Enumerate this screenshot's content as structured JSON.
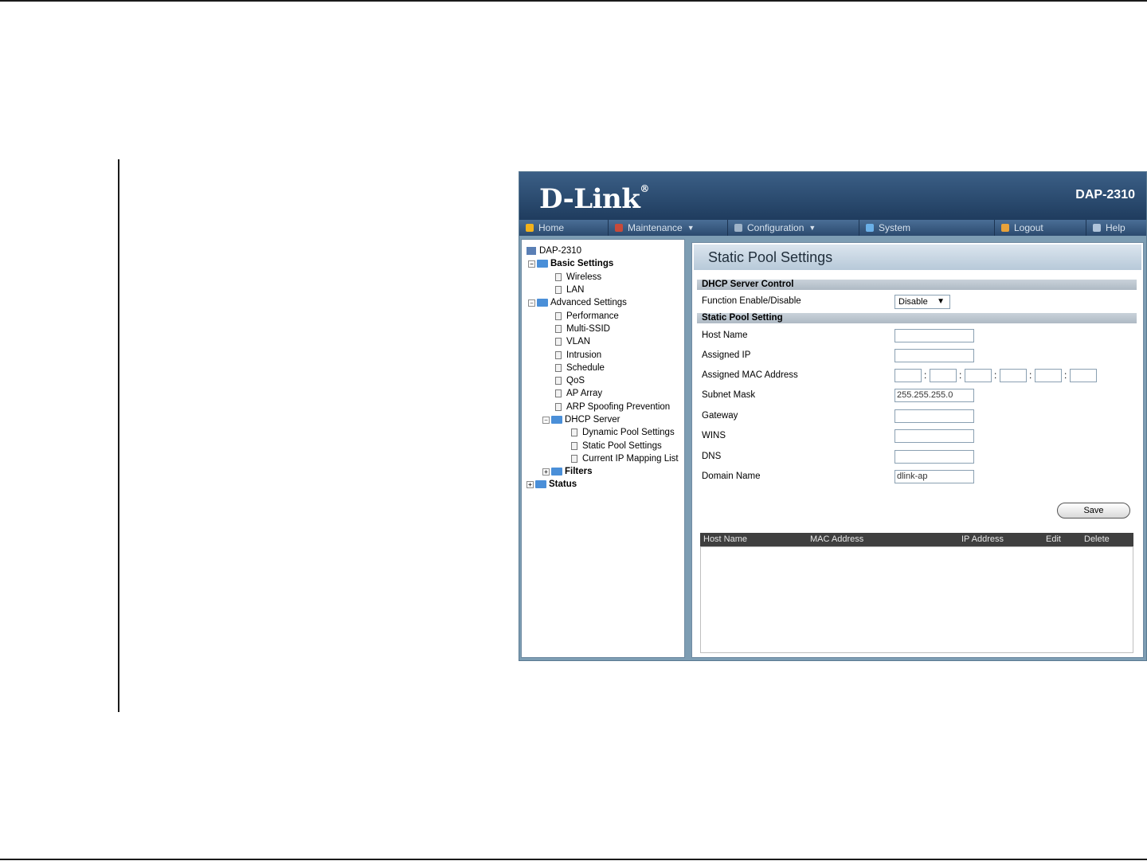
{
  "app": {
    "brand": "D-Link",
    "model": "DAP-2310"
  },
  "menu": [
    {
      "label": "Home",
      "color": "#f3b21b"
    },
    {
      "label": "Maintenance",
      "color": "#c74a3a",
      "has_caret": true
    },
    {
      "label": "Configuration",
      "color": "#9fb3c8",
      "has_caret": true
    },
    {
      "label": "System",
      "color": "#6ab0e8"
    },
    {
      "label": "Logout",
      "color": "#e8a23a"
    },
    {
      "label": "Help",
      "color": "#b0c4da"
    }
  ],
  "tree": {
    "root": "DAP-2310",
    "basic": "Basic Settings",
    "wireless": "Wireless",
    "lan": "LAN",
    "advanced": "Advanced Settings",
    "performance": "Performance",
    "multi_ssid": "Multi-SSID",
    "vlan": "VLAN",
    "intrusion": "Intrusion",
    "schedule": "Schedule",
    "qos": "QoS",
    "ap_array": "AP Array",
    "arp": "ARP Spoofing Prevention",
    "dhcp_server": "DHCP Server",
    "dynamic_pool": "Dynamic Pool Settings",
    "static_pool": "Static Pool Settings",
    "current_ip": "Current IP Mapping List",
    "filters": "Filters",
    "status": "Status"
  },
  "panel": {
    "title": "Static Pool Settings",
    "dhcp_section": "DHCP Server Control",
    "function_label": "Function Enable/Disable",
    "function_value": "Disable",
    "static_section": "Static Pool Setting",
    "host_name_label": "Host Name",
    "assigned_ip_label": "Assigned IP",
    "assigned_mac_label": "Assigned MAC Address",
    "subnet_mask_label": "Subnet Mask",
    "subnet_mask_value": "255.255.255.0",
    "gateway_label": "Gateway",
    "wins_label": "WINS",
    "dns_label": "DNS",
    "domain_name_label": "Domain Name",
    "domain_name_value": "dlink-ap",
    "save_label": "Save"
  },
  "table": {
    "headers": [
      "Host Name",
      "MAC Address",
      "IP Address",
      "Edit",
      "Delete"
    ]
  }
}
